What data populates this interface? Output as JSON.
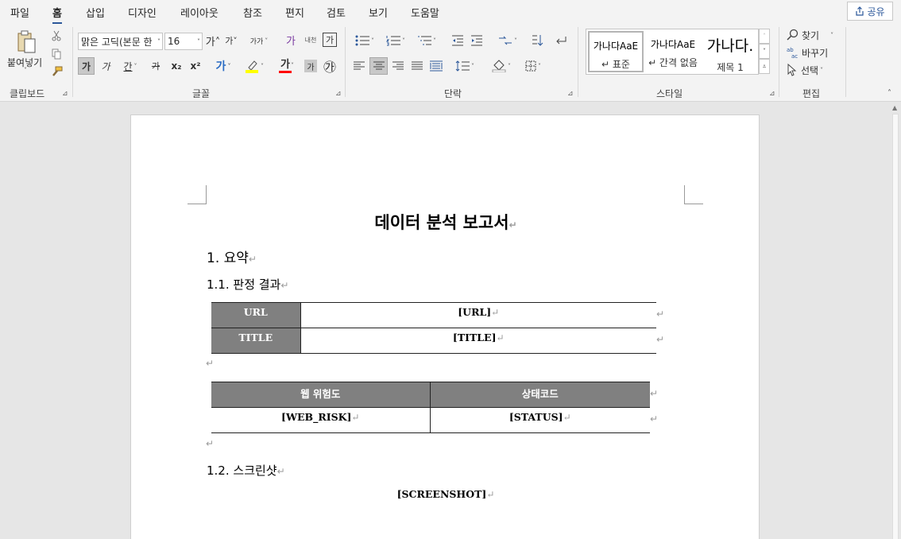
{
  "menu": {
    "tabs": [
      {
        "label": "파일"
      },
      {
        "label": "홈"
      },
      {
        "label": "삽입"
      },
      {
        "label": "디자인"
      },
      {
        "label": "레이아웃"
      },
      {
        "label": "참조"
      },
      {
        "label": "편지"
      },
      {
        "label": "검토"
      },
      {
        "label": "보기"
      },
      {
        "label": "도움말"
      }
    ],
    "active_tab": "홈",
    "share_label": "공유"
  },
  "ribbon": {
    "clipboard": {
      "paste_label": "붙여넣기",
      "group_label": "클립보드"
    },
    "font": {
      "font_name": "맑은 고딕(본문 한",
      "font_size": "16",
      "group_label": "글꼴",
      "bold_glyph": "가",
      "italic_glyph": "가",
      "underline_glyph": "간",
      "strike_glyph": "가",
      "sub_glyph": "x₂",
      "sup_glyph": "x²",
      "grow_glyph": "가˄",
      "shrink_glyph": "가˅",
      "case_glyph": "가가",
      "clear_glyph": "가",
      "phonetic_glyph": "내천",
      "border_glyph": "가",
      "effect_glyph": "가",
      "color_glyph": "가",
      "shade_glyph": "가",
      "enclose_glyph": "㉮",
      "highlight_color": "#ffff00",
      "font_color": "#ff0000"
    },
    "paragraph": {
      "group_label": "단락"
    },
    "styles": {
      "group_label": "스타일",
      "items": [
        {
          "preview": "가나다AaE",
          "name": "↵ 표준",
          "selected": true
        },
        {
          "preview": "가나다AaE",
          "name": "↵ 간격 없음",
          "selected": false
        },
        {
          "preview": "가나다.",
          "name": "제목 1",
          "selected": false
        }
      ]
    },
    "editing": {
      "group_label": "편집",
      "find_label": "찾기",
      "replace_label": "바꾸기",
      "select_label": "선택"
    }
  },
  "document": {
    "title": "데이터 분석 보고서",
    "heading1": "1. 요약",
    "heading1_1": "1.1. 판정 결과",
    "table1": [
      {
        "header": "URL",
        "value": "[URL]"
      },
      {
        "header": "TITLE",
        "value": "[TITLE]"
      }
    ],
    "table2": {
      "headers": [
        "웹 위험도",
        "상태코드"
      ],
      "values": [
        "[WEB_RISK]",
        "[STATUS]"
      ]
    },
    "heading1_2": "1.2. 스크린샷",
    "screenshot_placeholder": "[SCREENSHOT]",
    "paragraph_mark": "↵"
  },
  "colors": {
    "accent": "#2b579a",
    "table_header_bg": "#808080",
    "ribbon_bg": "#f3f3f3",
    "canvas_bg": "#e6e6e6"
  }
}
